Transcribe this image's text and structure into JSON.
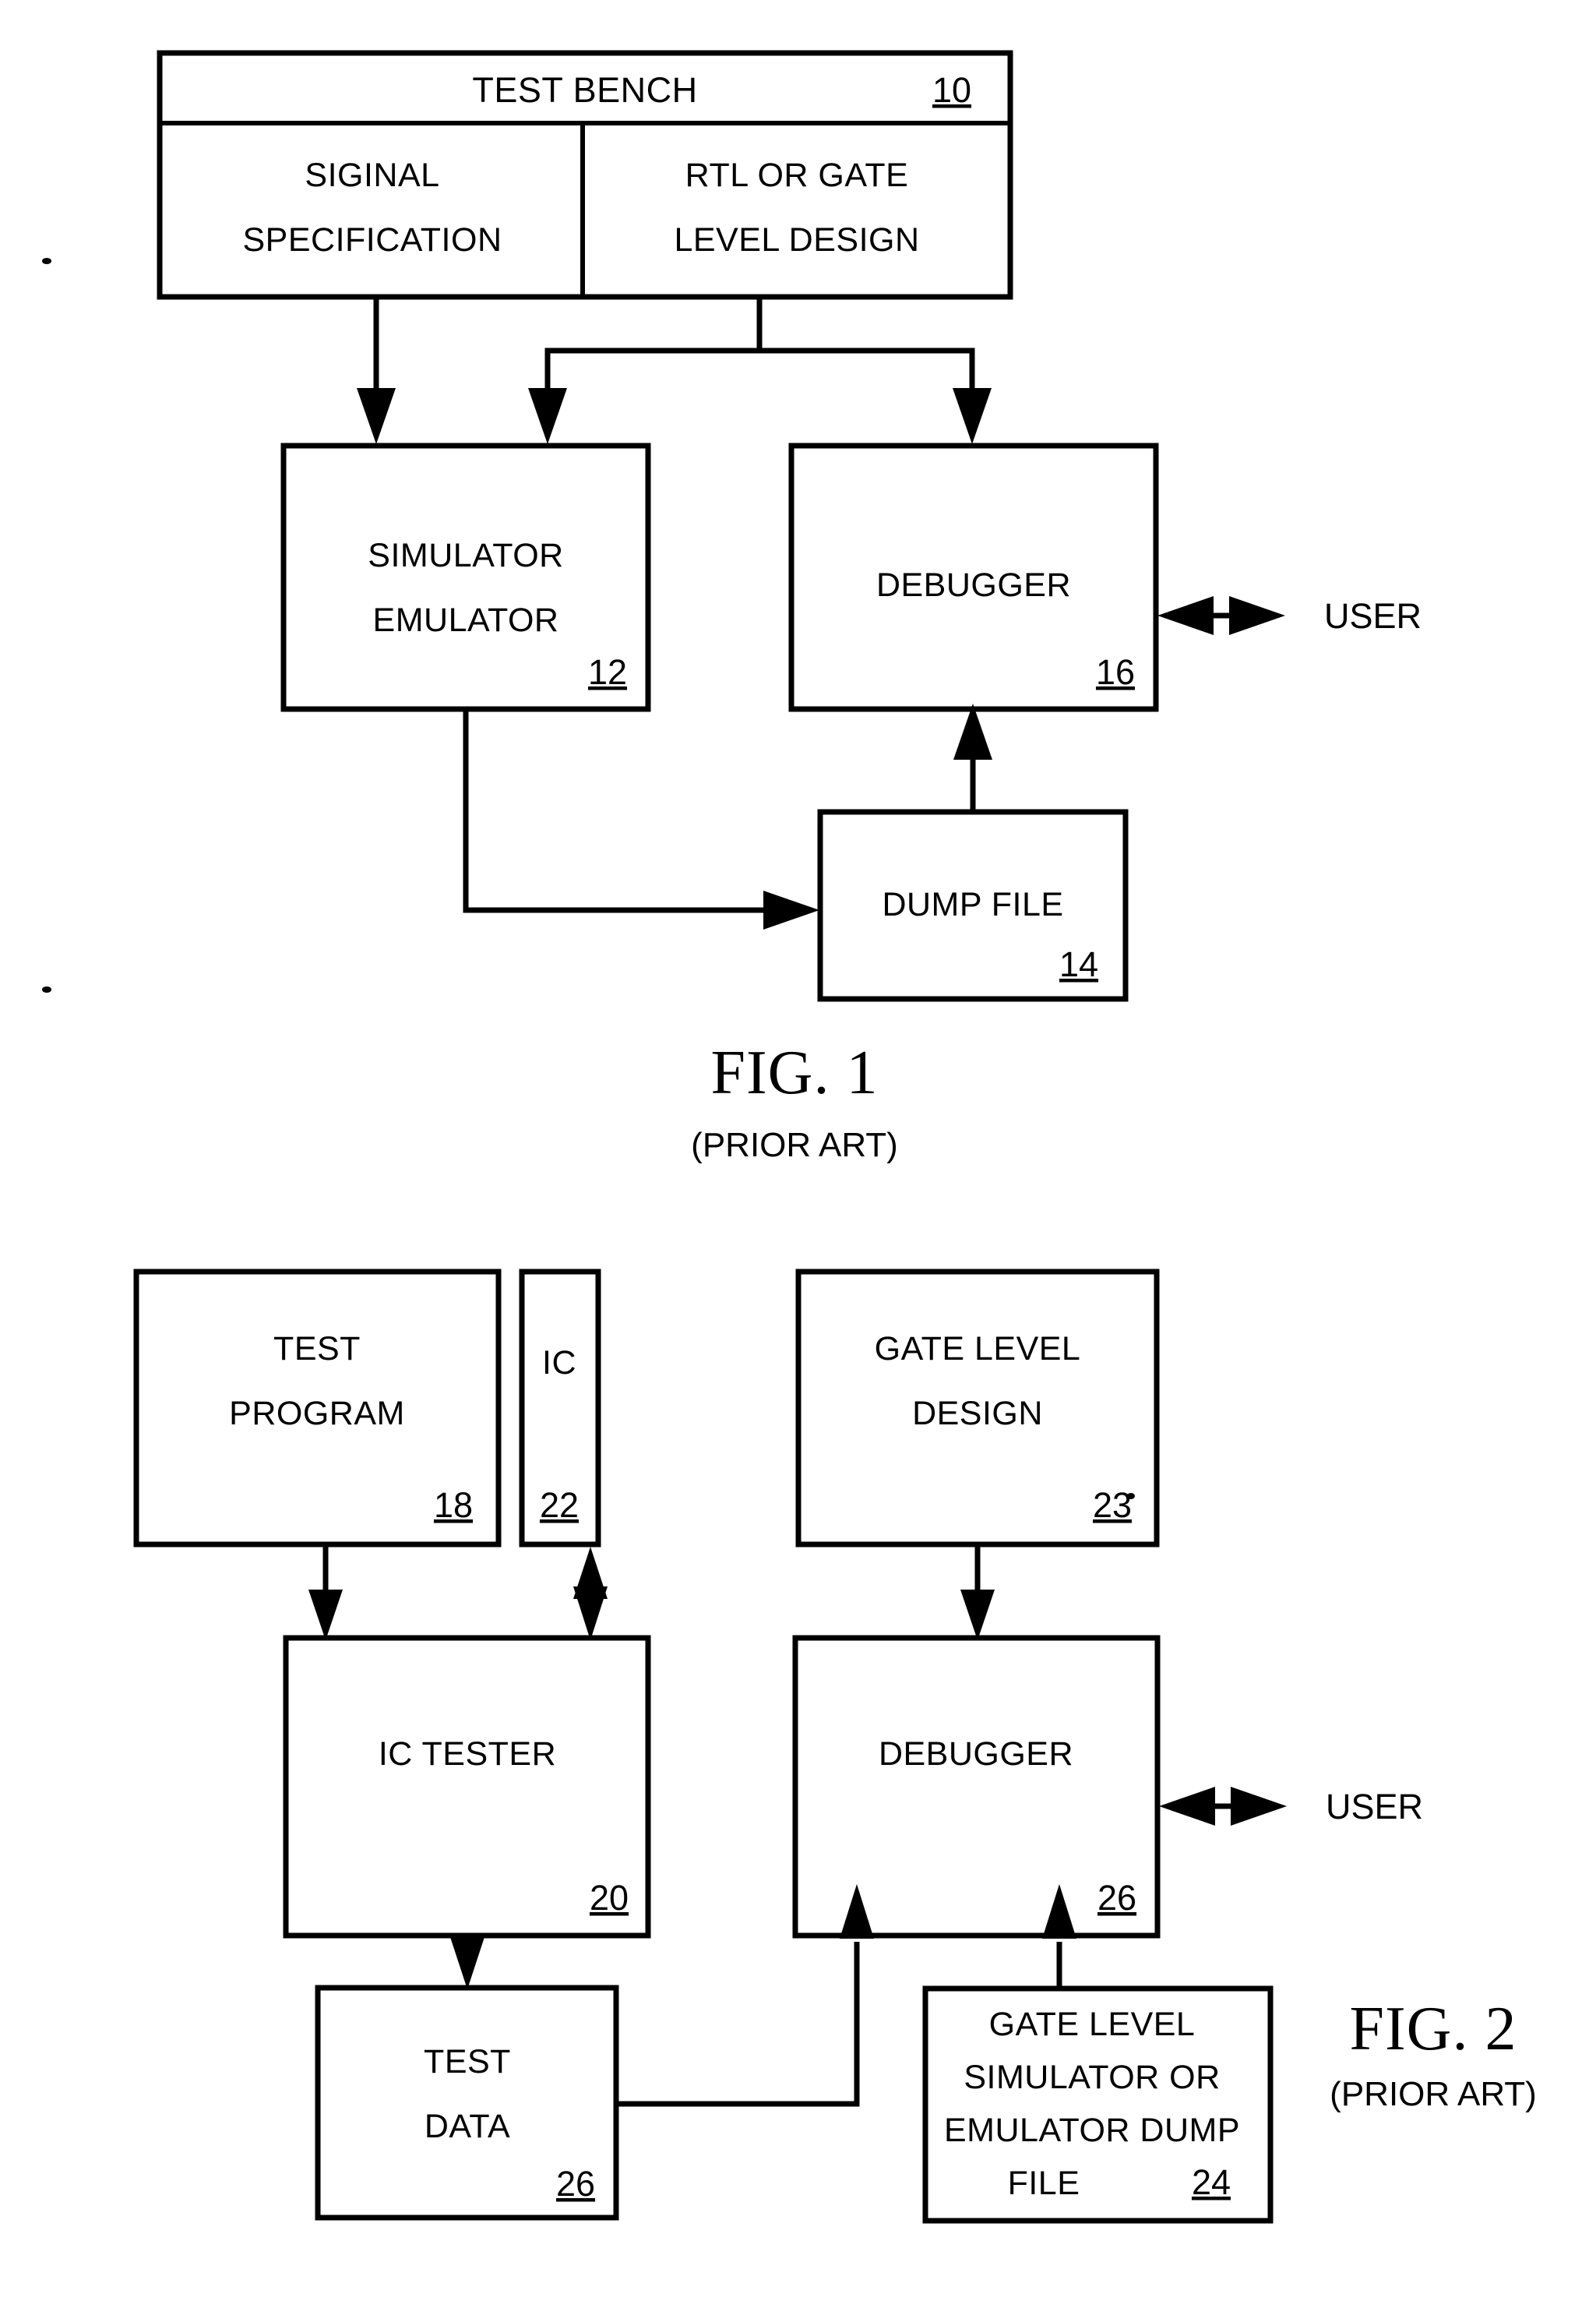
{
  "document": {
    "type": "patent-drawing-sheet",
    "background_color": "#ffffff",
    "ink_color": "#000000"
  },
  "figures": [
    {
      "id": "fig1",
      "title": "FIG. 1",
      "subtitle": "(PRIOR ART)",
      "boxes": [
        {
          "name": "test-bench",
          "header_label": "TEST BENCH",
          "ref": "10",
          "children": [
            {
              "name": "signal-specification",
              "lines": [
                "SIGINAL",
                "SPECIFICATION"
              ]
            },
            {
              "name": "rtl-or-gate-level-design",
              "lines": [
                "RTL OR GATE",
                "LEVEL DESIGN"
              ]
            }
          ]
        },
        {
          "name": "simulator-emulator",
          "lines": [
            "SIMULATOR",
            "EMULATOR"
          ],
          "ref": "12"
        },
        {
          "name": "debugger",
          "lines": [
            "DEBUGGER"
          ],
          "ref": "16"
        },
        {
          "name": "dump-file",
          "lines": [
            "DUMP FILE"
          ],
          "ref": "14"
        }
      ],
      "external_labels": [
        {
          "name": "user",
          "text": "USER"
        }
      ]
    },
    {
      "id": "fig2",
      "title": "FIG. 2",
      "subtitle": "(PRIOR ART)",
      "boxes": [
        {
          "name": "test-program",
          "lines": [
            "TEST",
            "PROGRAM"
          ],
          "ref": "18"
        },
        {
          "name": "ic",
          "lines": [
            "IC"
          ],
          "ref": "22"
        },
        {
          "name": "gate-level-design",
          "lines": [
            "GATE LEVEL",
            "DESIGN"
          ],
          "ref": "23"
        },
        {
          "name": "ic-tester",
          "lines": [
            "IC TESTER"
          ],
          "ref": "20"
        },
        {
          "name": "debugger",
          "lines": [
            "DEBUGGER"
          ],
          "ref": "26"
        },
        {
          "name": "test-data",
          "lines": [
            "TEST",
            "DATA"
          ],
          "ref": "26"
        },
        {
          "name": "gate-level-simulator-dump-file",
          "lines": [
            "GATE LEVEL",
            "SIMULATOR OR",
            "EMULATOR DUMP",
            "FILE"
          ],
          "ref": "24"
        }
      ],
      "external_labels": [
        {
          "name": "user",
          "text": "USER"
        }
      ]
    }
  ]
}
